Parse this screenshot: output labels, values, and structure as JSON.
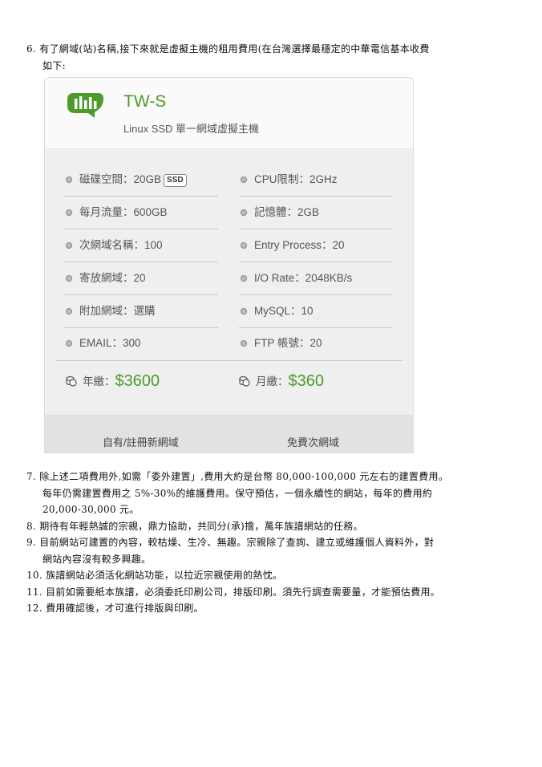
{
  "item6": {
    "number": "6.",
    "line1": "有了網域(站)名稱,接下來就是虛擬主機的租用費用(在台灣選擇最穩定的中華電信基本收費",
    "line2": "如下:"
  },
  "card": {
    "plan_name": "TW-S",
    "plan_desc": "Linux SSD 單一網域虛擬主機",
    "specs_left": [
      {
        "label": "磁碟空間：20GB",
        "tag": "SSD"
      },
      {
        "label": "每月流量：600GB"
      },
      {
        "label": "次網域名稱：100"
      },
      {
        "label": "寄放網域：20"
      },
      {
        "label": "附加網域：選購"
      },
      {
        "label": "EMAIL：300"
      }
    ],
    "specs_right": [
      {
        "label": "CPU限制：2GHz"
      },
      {
        "label": "記憶體：2GB"
      },
      {
        "label": "Entry Process：20"
      },
      {
        "label": "I/O Rate：2048KB/s"
      },
      {
        "label": "MySQL：10"
      },
      {
        "label": "FTP 帳號：20"
      }
    ],
    "price_year_label": "年繳：",
    "price_year": "$3600",
    "price_month_label": "月繳：",
    "price_month": "$360",
    "foot_left": "自有/註冊新網域",
    "foot_right": "免費次網域",
    "accent_color": "#4e9a2a"
  },
  "items": [
    {
      "number": "7.",
      "lines": [
        "除上述二項費用外,如需「委外建置」,費用大約是台幣 80,000-100,000 元左右的建置費用。",
        "每年仍需建置費用之 5%-30%的維護費用。保守預估，一個永續性的網站，每年的費用約",
        "20,000-30,000 元。"
      ]
    },
    {
      "number": "8.",
      "lines": [
        "期待有年輕熱誠的宗親，鼎力協助，共同分(承)擔，萬年族譜網站的任務。"
      ]
    },
    {
      "number": "9.",
      "lines": [
        "目前網站可建置的內容，較枯燥、生冷、無趣。宗親除了查詢、建立或維護個人資料外，對",
        "網站內容沒有較多興趣。"
      ]
    },
    {
      "number": "10.",
      "lines": [
        "族譜網站必須活化網站功能，以拉近宗親使用的熱忱。"
      ]
    },
    {
      "number": "11.",
      "lines": [
        "目前如需要紙本族譜，必須委託印刷公司，排版印刷。須先行調查需要量，才能預估費用。"
      ]
    },
    {
      "number": "12.",
      "lines": [
        "費用確認後，才可進行排版與印刷。"
      ]
    }
  ]
}
